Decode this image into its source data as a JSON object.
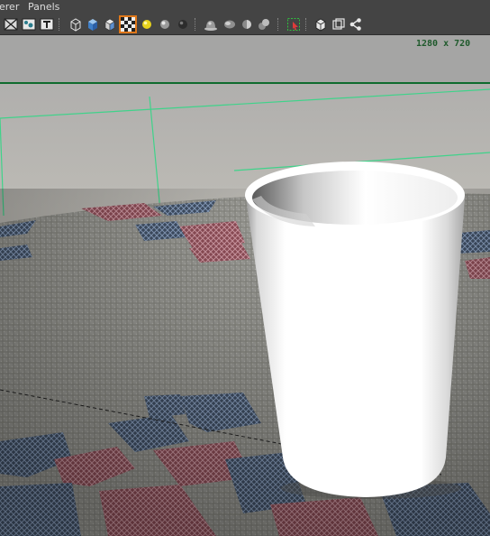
{
  "menubar": {
    "renderer_label": "erer",
    "panels_label": "Panels"
  },
  "toolbar": {
    "icons": [
      "wireframe-on-shaded-icon",
      "xray-icon",
      "texture-text-icon",
      "wireframe-cube-icon",
      "smooth-shade-cube-icon",
      "flat-shade-cube-icon",
      "textured-checker-icon",
      "default-light-icon",
      "all-lights-sphere-icon",
      "shadow-sphere-icon",
      "ambient-occlusion-icon",
      "motion-blur-icon",
      "anti-alias-icon",
      "depth-of-field-icon",
      "isolate-select-icon",
      "xray-joints-icon",
      "xray-active-icon",
      "node-graph-icon"
    ],
    "selected_icon": "textured-checker-icon"
  },
  "viewport": {
    "resolution_gate_label": "1280 x 720",
    "gate_line_color": "#0f6b2e",
    "grid_color": "#3fd38a",
    "background_color": "#b8b6b0"
  }
}
